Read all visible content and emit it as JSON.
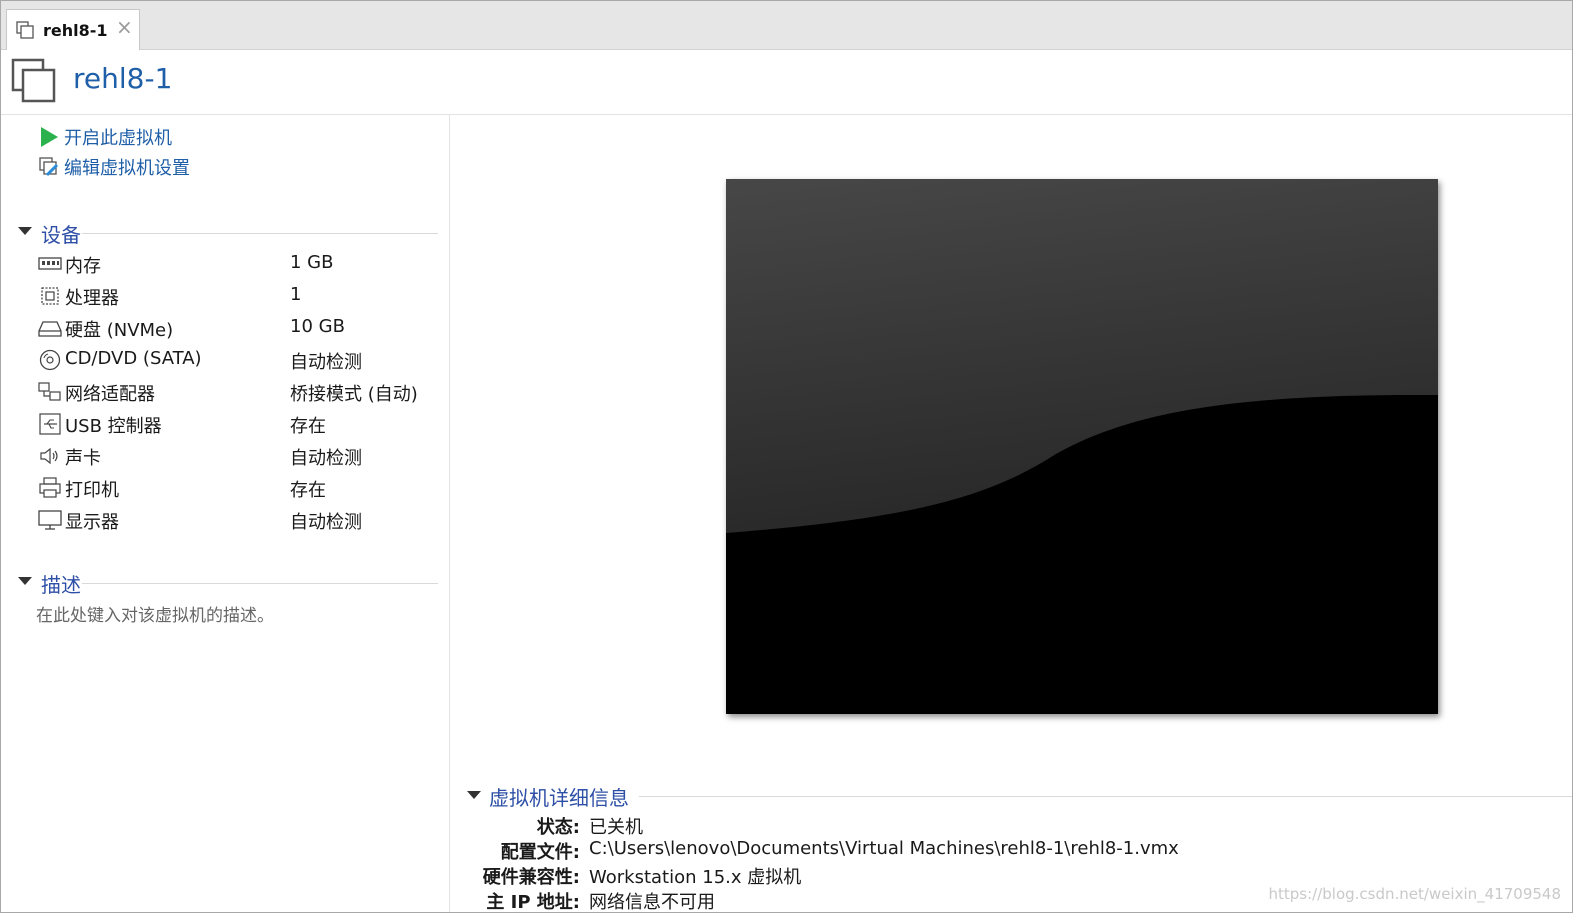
{
  "tab": {
    "label": "rehl8-1",
    "close_glyph": "×",
    "icon": "vm-icon"
  },
  "header": {
    "title": "rehl8-1",
    "icon": "vm-icon"
  },
  "actions": [
    {
      "label": "开启此虚拟机",
      "icon": "play-icon"
    },
    {
      "label": "编辑虚拟机设置",
      "icon": "edit-settings-icon"
    }
  ],
  "devices": {
    "title": "设备",
    "items": [
      {
        "name": "内存",
        "value": "1 GB",
        "icon": "memory-icon"
      },
      {
        "name": "处理器",
        "value": "1",
        "icon": "processor-icon"
      },
      {
        "name": "硬盘 (NVMe)",
        "value": "10 GB",
        "icon": "hard-disk-icon"
      },
      {
        "name": "CD/DVD (SATA)",
        "value": "自动检测",
        "icon": "cd-dvd-icon"
      },
      {
        "name": "网络适配器",
        "value": "桥接模式 (自动)",
        "icon": "network-adapter-icon"
      },
      {
        "name": "USB 控制器",
        "value": "存在",
        "icon": "usb-icon"
      },
      {
        "name": "声卡",
        "value": "自动检测",
        "icon": "speaker-icon"
      },
      {
        "name": "打印机",
        "value": "存在",
        "icon": "printer-icon"
      },
      {
        "name": "显示器",
        "value": "自动检测",
        "icon": "monitor-icon"
      }
    ]
  },
  "description": {
    "title": "描述",
    "placeholder": "在此处键入对该虚拟机的描述。"
  },
  "details": {
    "title": "虚拟机详细信息",
    "rows": [
      {
        "key": "状态:",
        "value": "已关机"
      },
      {
        "key": "配置文件:",
        "value": "C:\\Users\\lenovo\\Documents\\Virtual Machines\\rehl8-1\\rehl8-1.vmx"
      },
      {
        "key": "硬件兼容性:",
        "value": "Workstation 15.x 虚拟机"
      },
      {
        "key": "主 IP 地址:",
        "value": "网络信息不可用"
      }
    ]
  },
  "watermark": "https://blog.csdn.net/weixin_41709548",
  "colors": {
    "link": "#1f5fa8",
    "section": "#2d4fa6",
    "play": "#2bb24c"
  }
}
